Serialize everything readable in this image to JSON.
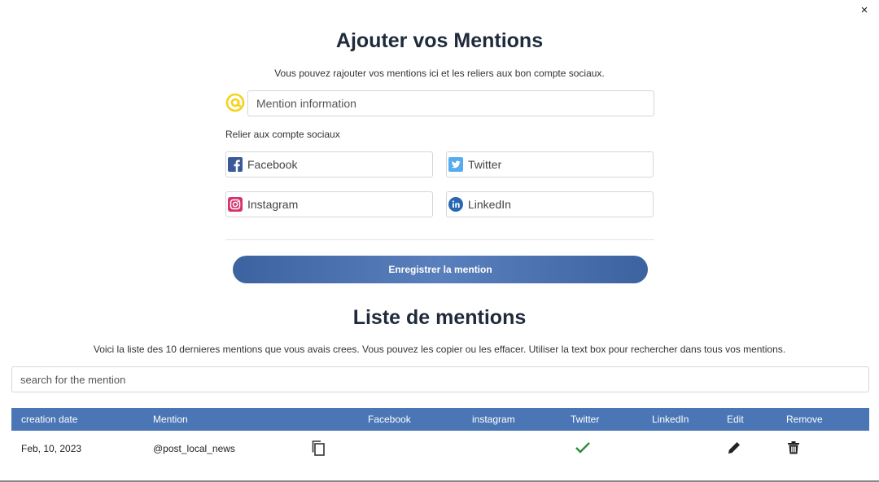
{
  "modal": {
    "close_label": "×",
    "title": "Ajouter vos Mentions",
    "subtitle": "Vous pouvez rajouter vos mentions ici et les reliers aux bon compte sociaux."
  },
  "form": {
    "mention_placeholder": "Mention information",
    "mention_value": "",
    "relier_label": "Relier aux compte sociaux",
    "socials": {
      "facebook": {
        "placeholder": "Facebook",
        "icon": "facebook-icon",
        "color": "#3b5998"
      },
      "twitter": {
        "placeholder": "Twitter",
        "icon": "twitter-icon",
        "color": "#55acee"
      },
      "instagram": {
        "placeholder": "Instagram",
        "icon": "instagram-icon",
        "color": "#d6336c"
      },
      "linkedin": {
        "placeholder": "LinkedIn",
        "icon": "linkedin-icon",
        "color": "#2867b2"
      }
    },
    "save_label": "Enregistrer la mention"
  },
  "list": {
    "title": "Liste de mentions",
    "description": "Voici la liste des 10 dernieres mentions que vous avais crees. Vous pouvez les copier ou les effacer. Utiliser la text box pour rechercher dans tous vos mentions.",
    "search_placeholder": "search for the mention",
    "columns": [
      "creation date",
      "Mention",
      "Facebook",
      "instagram",
      "Twitter",
      "LinkedIn",
      "Edit",
      "Remove"
    ],
    "rows": [
      {
        "creation_date": "Feb, 10, 2023",
        "mention": "@post_local_news",
        "facebook": false,
        "instagram": false,
        "twitter": true,
        "linkedin": false
      }
    ]
  },
  "colors": {
    "accent": "#4a76b5",
    "at_icon": "#f3d31c",
    "check": "#2e8b3e"
  }
}
